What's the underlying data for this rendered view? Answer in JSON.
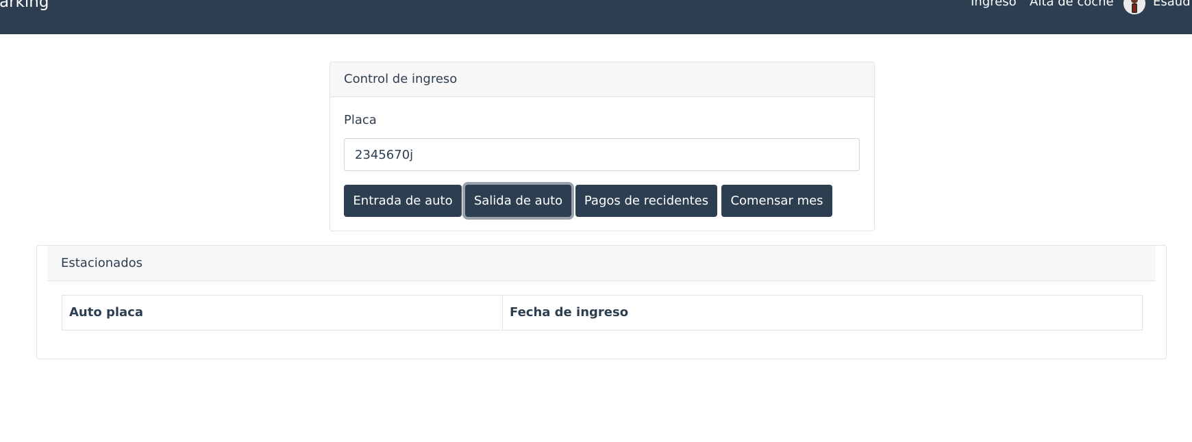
{
  "navbar": {
    "brand": "arking",
    "links": [
      "Ingreso",
      "Alta de coche"
    ],
    "user_name": "Esaud",
    "bg_color": "#2c3e50"
  },
  "control": {
    "header": "Control de ingreso",
    "placa_label": "Placa",
    "placa_value": "2345670j",
    "buttons": {
      "entrada": "Entrada de auto",
      "salida": "Salida de auto",
      "pagos": "Pagos de recidentes",
      "comensar": "Comensar mes"
    },
    "focused_button": "salida"
  },
  "estacionados": {
    "header": "Estacionados",
    "columns": [
      "Auto placa",
      "Fecha de ingreso"
    ],
    "rows": []
  },
  "colors": {
    "primary": "#2c3e50",
    "card_header_bg": "#f7f7f7",
    "border": "#dfe3e6"
  }
}
